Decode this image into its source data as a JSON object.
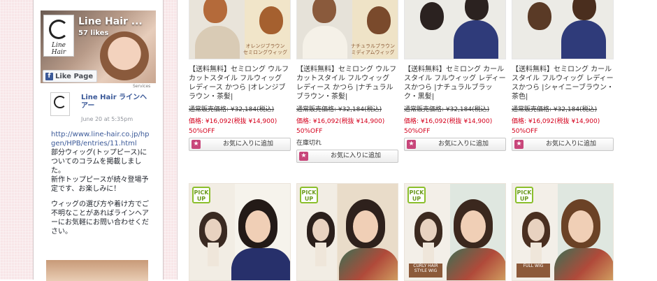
{
  "facebook": {
    "page_name": "Line Hair ...",
    "likes": "57 likes",
    "like_button": "Like Page",
    "services": "Services",
    "logo_text": "Line Hair",
    "post": {
      "author": "Line Hair ラインヘアー",
      "date": "June 20 at 5:35pm",
      "link": "http://www.line-hair.co.jp/hpgen/HPB/entries/11.html",
      "p1": "部分ウィッグ(トップピース)についてのコラムを掲載しました。",
      "p2": "新作トップピースが続々登場予定です、お楽しみに！",
      "p3": "ウィッグの選び方や着け方でご不明なことがあればラインヘアーにお気軽にお問い合わせください。"
    }
  },
  "products": [
    {
      "title": "【送料無料】セミロング ウルフカットスタイル フルウィッグ レディース かつら |オレンジブラウン・茶髪|",
      "regular_price": "通常販売価格: ¥32,184(税込)",
      "sale_price": "価格: ¥16,092(税抜 ¥14,900)",
      "discount": "50%OFF",
      "status": "",
      "fav_button": "お気に入りに追加",
      "caption": "オレンジブラウン\nセミロングウィッグ"
    },
    {
      "title": "【送料無料】セミロング ウルフカットスタイル フルウィッグ レディース かつら |ナチュラルブラウン・茶髪|",
      "regular_price": "通常販売価格: ¥32,184(税込)",
      "sale_price": "価格: ¥16,092(税抜 ¥14,900)",
      "discount": "50%OFF",
      "status": "在庫切れ",
      "fav_button": "お気に入りに追加",
      "caption": "ナチュラルブラウン\nミディアムウィッグ"
    },
    {
      "title": "【送料無料】セミロング カールスタイル フルウィッグ レディースかつら |ナチュラルブラック・黒髪|",
      "regular_price": "通常販売価格: ¥32,184(税込)",
      "sale_price": "価格: ¥16,092(税抜 ¥14,900)",
      "discount": "50%OFF",
      "status": "",
      "fav_button": "お気に入りに追加",
      "caption": ""
    },
    {
      "title": "【送料無料】セミロング カールスタイル フルウィッグ レディースかつら |シャイニーブラウン・茶色|",
      "regular_price": "通常販売価格: ¥32,184(税込)",
      "sale_price": "価格: ¥16,092(税抜 ¥14,900)",
      "discount": "50%OFF",
      "status": "",
      "fav_button": "お気に入りに追加",
      "caption": ""
    }
  ],
  "pickups": [
    {
      "badge": "PICK UP",
      "tag": ""
    },
    {
      "badge": "PICK UP",
      "tag": ""
    },
    {
      "badge": "PICK UP",
      "tag": "CURLY HAIR STYLE WIG"
    },
    {
      "badge": "PICK UP",
      "tag": "FULL WIG"
    }
  ]
}
